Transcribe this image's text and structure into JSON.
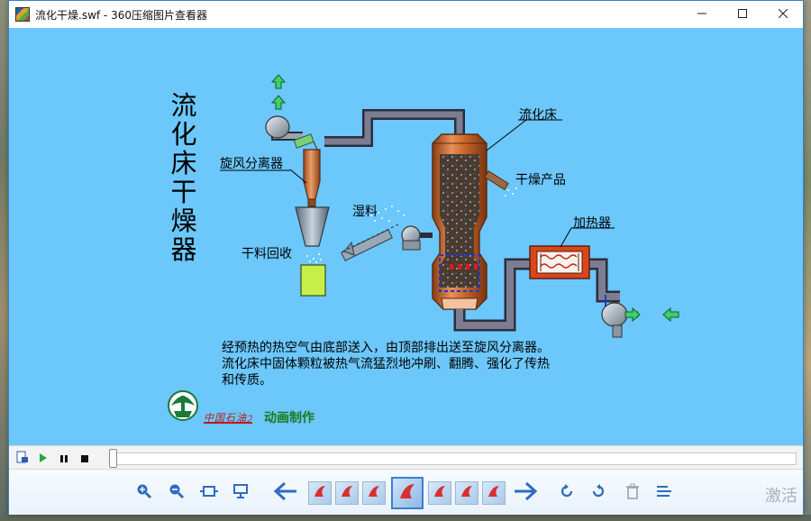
{
  "window": {
    "title": "流化干燥.swf - 360压缩图片查看器",
    "controls": {
      "minimize": "—",
      "maximize": "☐",
      "close": "✕"
    }
  },
  "flash": {
    "main_title": [
      "流",
      "化",
      "床",
      "干",
      "燥",
      "器"
    ],
    "labels": {
      "cyclone": "旋风分离器",
      "bed": "流化床",
      "product": "干燥产品",
      "wet": "湿料",
      "heater": "加热器",
      "recovery": "干料回收"
    },
    "description": [
      "经预热的热空气由底部送入，由顶部排出送至旋风分离器。",
      "流化床中固体颗粒被热气流猛烈地冲刷、翻腾、强化了传热",
      "和传质。"
    ],
    "school_name": "中国石油大学",
    "credit": "动画制作",
    "colors": {
      "stage_bg": "#6cc7fb",
      "pipe": "#5a5a6e",
      "vessel": "#c86a2e",
      "heater": "#d84a1e",
      "arrow": "#2fd05a"
    }
  },
  "player": {
    "icons": [
      "file-info-icon",
      "play-icon",
      "pause-icon",
      "stop-icon"
    ],
    "progress_fraction": 0.0
  },
  "toolbar": {
    "icons": [
      "zoom-in-icon",
      "zoom-out-icon",
      "fit-window-icon",
      "slideshow-icon",
      "previous-icon",
      "next-icon",
      "rotate-left-icon",
      "rotate-right-icon",
      "delete-icon",
      "menu-icon"
    ],
    "thumbnail_count": 7,
    "active_thumbnail_index": 3
  },
  "desktop": {
    "watermark": "激活"
  }
}
